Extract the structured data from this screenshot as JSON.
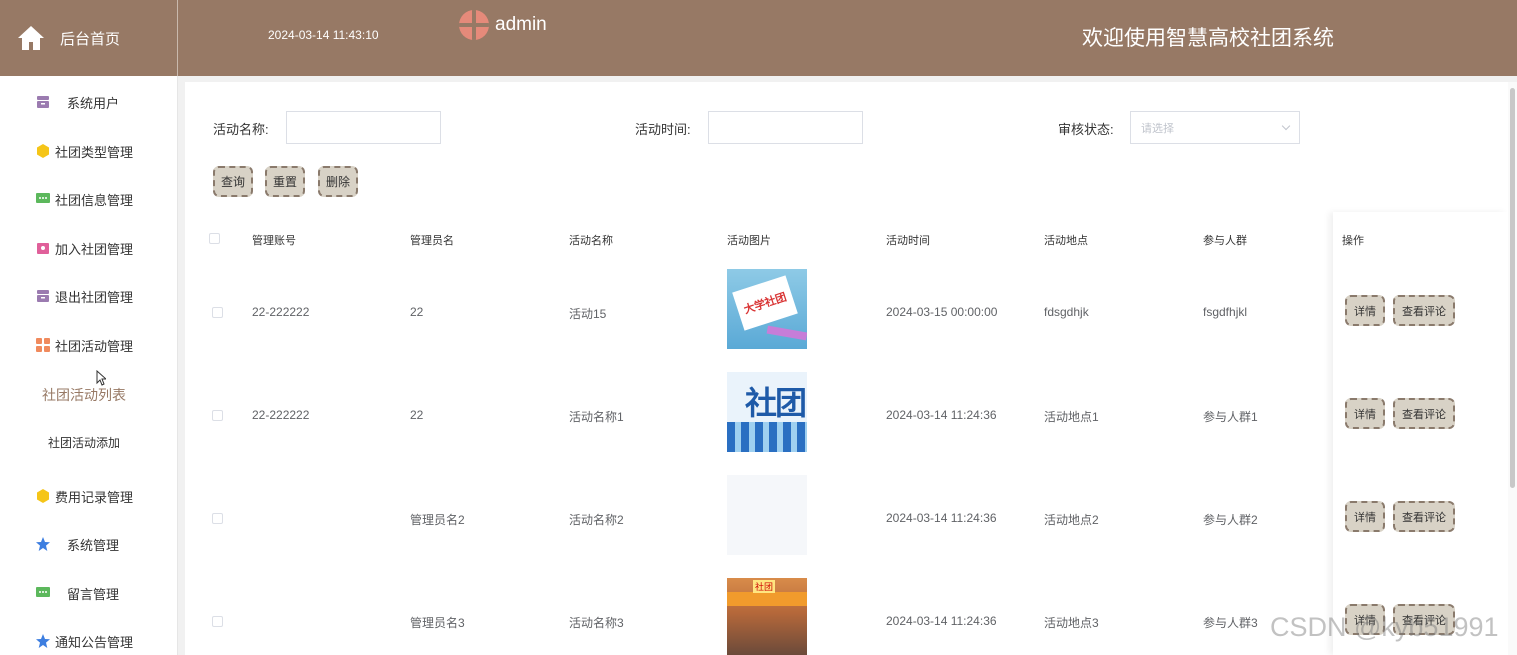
{
  "header": {
    "home_label": "后台首页",
    "datetime": "2024-03-14 11:43:10",
    "username": "admin",
    "welcome": "欢迎使用智慧高校社团系统",
    "bg_color": "#977965"
  },
  "sidebar": {
    "items": [
      {
        "label": "系统用户",
        "icon": "archive-icon"
      },
      {
        "label": "社团类型管理",
        "icon": "hexagon-icon"
      },
      {
        "label": "社团信息管理",
        "icon": "message-icon"
      },
      {
        "label": "加入社团管理",
        "icon": "gift-icon"
      },
      {
        "label": "退出社团管理",
        "icon": "archive-icon"
      },
      {
        "label": "社团活动管理",
        "icon": "grid-icon"
      },
      {
        "label": "费用记录管理",
        "icon": "hexagon-icon"
      },
      {
        "label": "系统管理",
        "icon": "star-icon"
      },
      {
        "label": "留言管理",
        "icon": "message-icon"
      },
      {
        "label": "通知公告管理",
        "icon": "star-icon"
      }
    ],
    "sub_items": [
      {
        "label": "社团活动列表",
        "active": true
      },
      {
        "label": "社团活动添加",
        "active": false
      }
    ]
  },
  "search": {
    "name_label": "活动名称:",
    "time_label": "活动时间:",
    "status_label": "审核状态:",
    "status_placeholder": "请选择",
    "query_btn": "查询",
    "reset_btn": "重置",
    "delete_btn": "删除"
  },
  "table": {
    "headers": [
      "管理账号",
      "管理员名",
      "活动名称",
      "活动图片",
      "活动时间",
      "活动地点",
      "参与人群",
      "操作"
    ],
    "rows": [
      {
        "account": "22-222222",
        "admin_name": "22",
        "activity_name": "活动15",
        "time": "2024-03-15 00:00:00",
        "place": "fdsgdhjk",
        "crowd": "fsgdfhjkl",
        "image_text": "大学社团"
      },
      {
        "account": "22-222222",
        "admin_name": "22",
        "activity_name": "活动名称1",
        "time": "2024-03-14 11:24:36",
        "place": "活动地点1",
        "crowd": "参与人群1",
        "image_text": "社团"
      },
      {
        "account": "",
        "admin_name": "管理员名2",
        "activity_name": "活动名称2",
        "time": "2024-03-14 11:24:36",
        "place": "活动地点2",
        "crowd": "参与人群2",
        "image_text": ""
      },
      {
        "account": "",
        "admin_name": "管理员名3",
        "activity_name": "活动名称3",
        "time": "2024-03-14 11:24:36",
        "place": "活动地点3",
        "crowd": "参与人群3",
        "image_text": "社团"
      }
    ],
    "detail_btn": "详情",
    "comment_btn": "查看评论"
  },
  "watermark": "CSDN @kyb51991"
}
